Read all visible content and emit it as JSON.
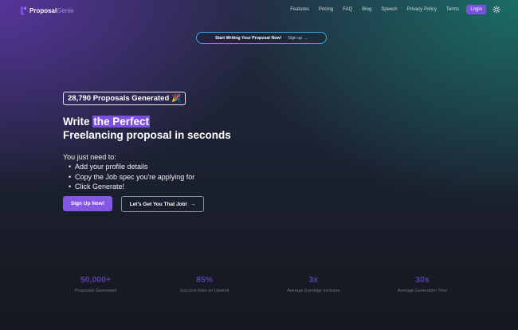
{
  "nav": {
    "logo": {
      "part1": "Proposal",
      "part2": "Genie"
    },
    "links": [
      "Features",
      "Pricing",
      "FAQ",
      "Blog",
      "Speech",
      "Privacy Policy",
      "Terms"
    ],
    "login_label": "Login",
    "theme_icon": "sun-icon"
  },
  "banner": {
    "text": "Start Writing Your Proposal Now!",
    "signup": "Sign up →"
  },
  "hero": {
    "counter": "28,790 Proposals Generated",
    "counter_emoji": "🎉",
    "headline_prefix": "Write ",
    "headline_accent": "the Perfect",
    "headline_line2": "Freelancing proposal in seconds",
    "needs_title": "You just need to:",
    "needs_items": [
      "Add your profile details",
      "Copy the Job spec you're applying for",
      "Click Generate!"
    ],
    "primary_cta": "Sign Up Now!",
    "secondary_cta": "Let's Get You That Job!",
    "secondary_arrow": "→"
  },
  "stats": [
    {
      "value": "50,000+",
      "label": "Proposals Generated"
    },
    {
      "value": "85%",
      "label": "Success Rate on Upwork"
    },
    {
      "value": "3x",
      "label": "Average Earnings Increase"
    },
    {
      "value": "30s",
      "label": "Average Generation Time"
    }
  ],
  "colors": {
    "accent": "#7b4fe0",
    "banner_border": "#3ba9d8",
    "stat_value": "#5a3fa0"
  }
}
